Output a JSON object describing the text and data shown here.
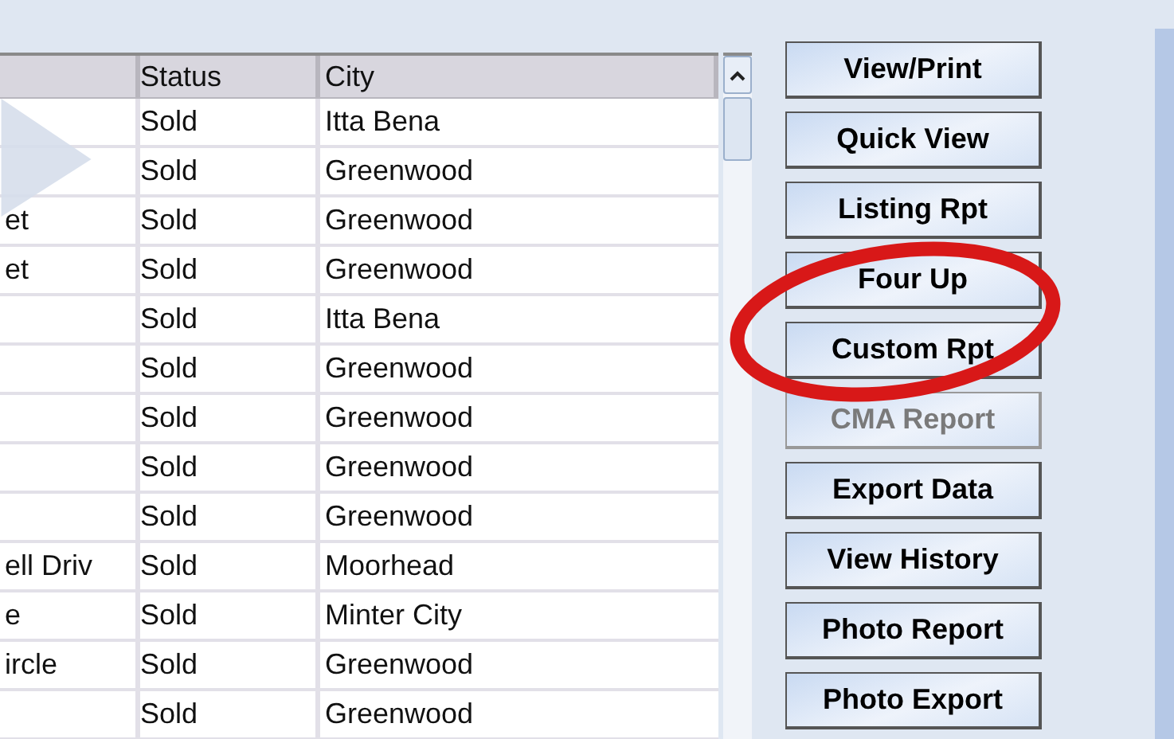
{
  "table": {
    "columns": [
      {
        "kind": "blank"
      },
      {
        "kind": "text",
        "label": "Status"
      },
      {
        "kind": "text",
        "label": "City"
      }
    ],
    "rows": [
      {
        "cells": [
          "",
          "Sold",
          "Itta Bena"
        ]
      },
      {
        "cells": [
          "",
          "Sold",
          "Greenwood"
        ]
      },
      {
        "cells": [
          "et",
          "Sold",
          "Greenwood"
        ]
      },
      {
        "cells": [
          "et",
          "Sold",
          "Greenwood"
        ]
      },
      {
        "cells": [
          "",
          "Sold",
          "Itta Bena"
        ]
      },
      {
        "cells": [
          "",
          "Sold",
          "Greenwood"
        ]
      },
      {
        "cells": [
          "",
          "Sold",
          "Greenwood"
        ]
      },
      {
        "cells": [
          "",
          "Sold",
          "Greenwood"
        ]
      },
      {
        "cells": [
          "",
          "Sold",
          "Greenwood"
        ]
      },
      {
        "cells": [
          "ell Driv",
          "Sold",
          "Moorhead"
        ]
      },
      {
        "cells": [
          "e",
          "Sold",
          "Minter City"
        ]
      },
      {
        "cells": [
          "ircle",
          "Sold",
          "Greenwood"
        ]
      },
      {
        "cells": [
          "",
          "Sold",
          "Greenwood"
        ]
      }
    ]
  },
  "buttons": [
    {
      "label": "View/Print",
      "disabled": false
    },
    {
      "label": "Quick View",
      "disabled": false
    },
    {
      "label": "Listing Rpt",
      "disabled": false
    },
    {
      "label": "Four Up",
      "disabled": false
    },
    {
      "label": "Custom Rpt",
      "disabled": false
    },
    {
      "label": "CMA Report",
      "disabled": true
    },
    {
      "label": "Export Data",
      "disabled": false
    },
    {
      "label": "View History",
      "disabled": false
    },
    {
      "label": "Photo Report",
      "disabled": false
    },
    {
      "label": "Photo Export",
      "disabled": false
    }
  ]
}
